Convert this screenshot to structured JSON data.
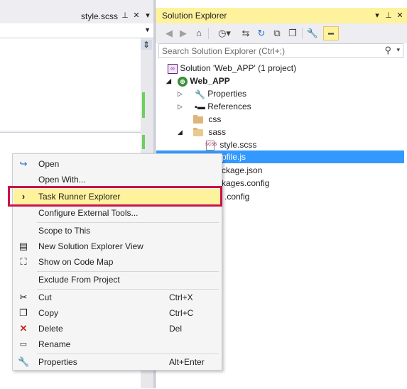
{
  "editor": {
    "tab_title": "style.scss",
    "pin_icon": "pin-icon",
    "close_icon": "close-icon",
    "dropdown_icon": "chevron-down-icon",
    "split_icon": "split-icon"
  },
  "solution_explorer": {
    "title": "Solution Explorer",
    "search_placeholder": "Search Solution Explorer (Ctrl+;)",
    "toolbar": [
      "back-icon",
      "forward-icon",
      "home-icon",
      "history-icon",
      "sync-icon",
      "refresh-icon",
      "collapse-icon",
      "copy-icon",
      "properties-icon",
      "preview-icon"
    ],
    "tree": {
      "solution": "Solution 'Web_APP' (1 project)",
      "project": "Web_APP",
      "properties": "Properties",
      "references": "References",
      "css": "css",
      "sass": "sass",
      "style_scss": "style.scss",
      "gulpfile": "pfile.js",
      "package_json": "ckage.json",
      "packages_config": "kages.config",
      "web_config": ".config"
    }
  },
  "context_menu": {
    "items": [
      {
        "label": "Open",
        "shortcut": "",
        "icon": "open-icon"
      },
      {
        "label": "Open With...",
        "shortcut": "",
        "icon": ""
      },
      {
        "label": "Task Runner Explorer",
        "shortcut": "",
        "icon": "chevron-right-icon"
      },
      {
        "label": "Configure External Tools...",
        "shortcut": "",
        "icon": ""
      },
      {
        "label": "Scope to This",
        "shortcut": "",
        "icon": ""
      },
      {
        "label": "New Solution Explorer View",
        "shortcut": "",
        "icon": "new-view-icon"
      },
      {
        "label": "Show on Code Map",
        "shortcut": "",
        "icon": "code-map-icon"
      },
      {
        "label": "Exclude From Project",
        "shortcut": "",
        "icon": ""
      },
      {
        "label": "Cut",
        "shortcut": "Ctrl+X",
        "icon": "scissors-icon"
      },
      {
        "label": "Copy",
        "shortcut": "Ctrl+C",
        "icon": "copy-icon"
      },
      {
        "label": "Delete",
        "shortcut": "Del",
        "icon": "delete-icon"
      },
      {
        "label": "Rename",
        "shortcut": "",
        "icon": "rename-icon"
      },
      {
        "label": "Properties",
        "shortcut": "Alt+Enter",
        "icon": "wrench-icon"
      }
    ]
  },
  "colors": {
    "accent_yellow": "#fff29d",
    "selection_blue": "#3399ff",
    "highlight_red": "#c8134b"
  }
}
